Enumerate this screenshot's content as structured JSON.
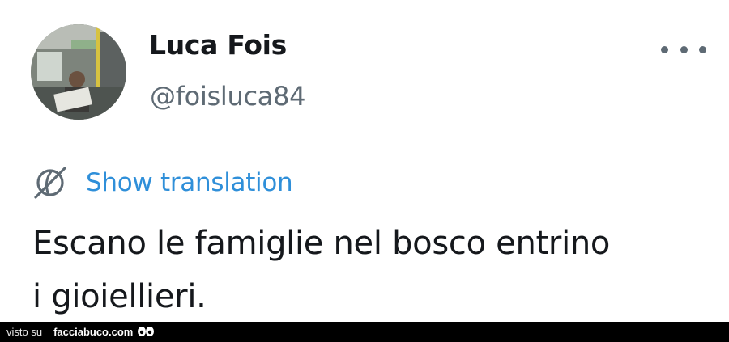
{
  "tweet": {
    "author_name": "Luca Fois",
    "author_handle": "@foisluca84",
    "translate_label": "Show translation",
    "text_line_1": "Escano le famiglie nel bosco entrino",
    "text_line_2": "i gioiellieri."
  },
  "footer": {
    "prefix": "visto su",
    "site": "facciabuco.com"
  },
  "icons": {
    "more": "more-options-icon",
    "translate": "globe-translate-icon",
    "footer_logo": "eyes-logo-icon"
  },
  "colors": {
    "link": "#2f8fd9",
    "text": "#15181c",
    "secondary": "#5e6a74",
    "footer_bg": "#000000"
  }
}
